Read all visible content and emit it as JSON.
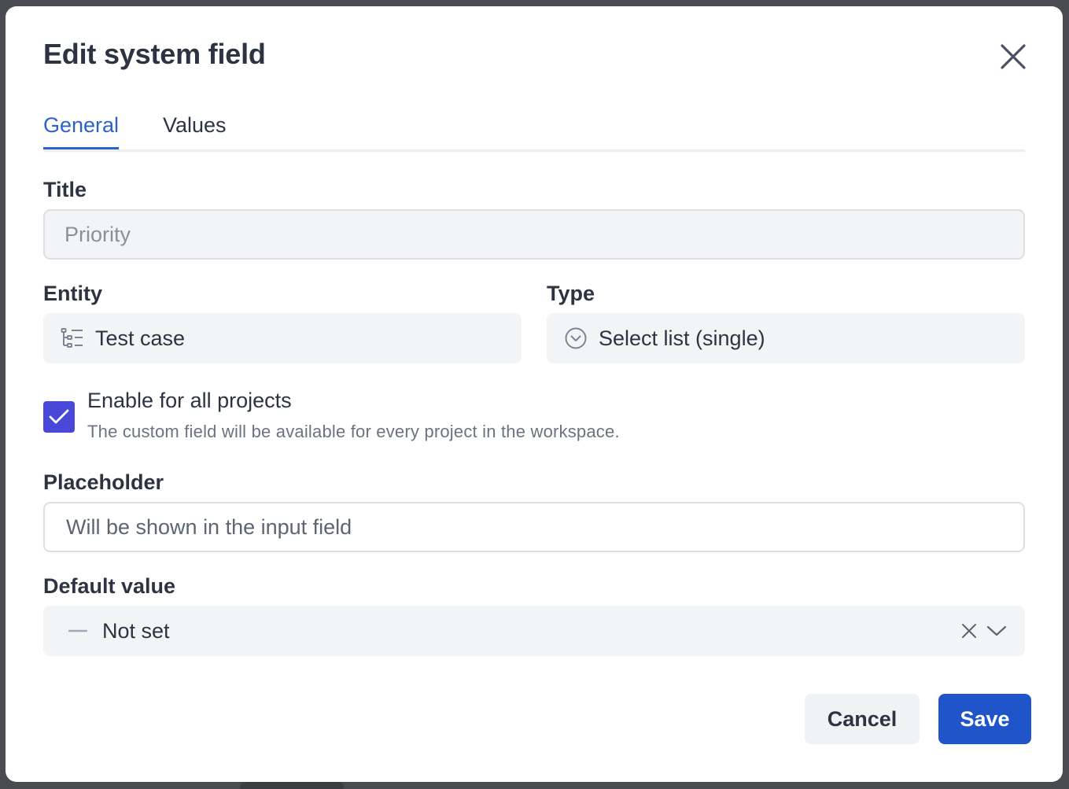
{
  "dialog": {
    "title": "Edit system field"
  },
  "tabs": [
    {
      "label": "General",
      "active": true
    },
    {
      "label": "Values",
      "active": false
    }
  ],
  "form": {
    "title_label": "Title",
    "title_value": "Priority",
    "entity_label": "Entity",
    "entity_value": "Test case",
    "entity_icon": "tree-list-icon",
    "type_label": "Type",
    "type_value": "Select list (single)",
    "type_icon": "circle-chevron-down-icon",
    "enable_all_label": "Enable for all projects",
    "enable_all_checked": true,
    "enable_all_description": "The custom field will be available for every project in the workspace.",
    "placeholder_label": "Placeholder",
    "placeholder_placeholder": "Will be shown in the input field",
    "default_label": "Default value",
    "default_value": "Not set",
    "default_icon": "dash-icon"
  },
  "actions": {
    "cancel_label": "Cancel",
    "save_label": "Save"
  },
  "colors": {
    "accent": "#2d62c6",
    "checkbox": "#4a48d8",
    "primary_button": "#1f55c9",
    "overlay": "#4a4b4f"
  }
}
